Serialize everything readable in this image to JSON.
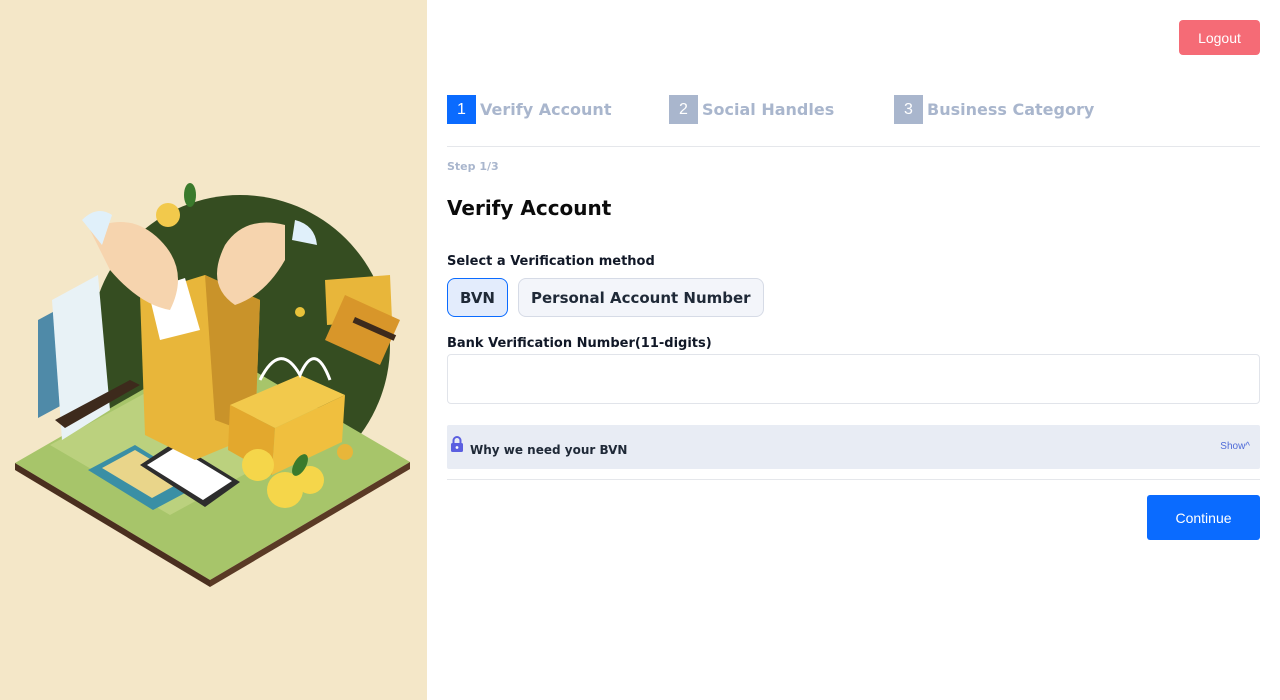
{
  "header": {
    "logout_label": "Logout"
  },
  "stepper": {
    "steps": [
      {
        "number": "1",
        "label": "Verify Account"
      },
      {
        "number": "2",
        "label": "Social Handles"
      },
      {
        "number": "3",
        "label": "Business Category"
      }
    ],
    "active_step": 1
  },
  "form": {
    "step_indicator": "Step 1/3",
    "title": "Verify Account",
    "method_label": "Select a Verification method",
    "methods": [
      "BVN",
      "Personal Account Number"
    ],
    "selected_method": "BVN",
    "bvn_label": "Bank Verification Number(11-digits)",
    "bvn_value": "",
    "info_text": "Why we need your BVN",
    "info_toggle": "Show^",
    "continue_label": "Continue"
  },
  "icons": {
    "lock": "lock-icon",
    "illustration": "shopping-illustration"
  },
  "colors": {
    "accent": "#0a6bff",
    "logout": "#f56b76",
    "left_panel": "#f4e7c8",
    "inactive_step": "#a9b6cd"
  }
}
